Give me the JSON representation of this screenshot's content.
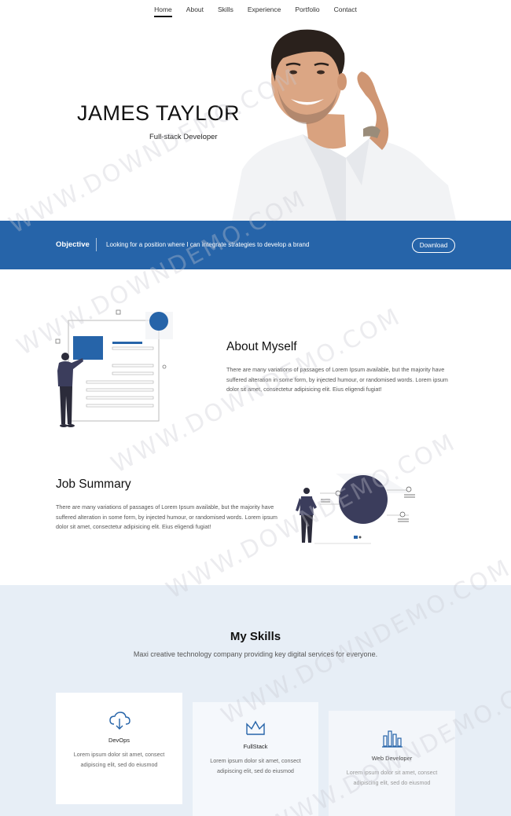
{
  "nav": {
    "items": [
      {
        "label": "Home",
        "active": true
      },
      {
        "label": "About",
        "active": false
      },
      {
        "label": "Skills",
        "active": false
      },
      {
        "label": "Experience",
        "active": false
      },
      {
        "label": "Portfolio",
        "active": false
      },
      {
        "label": "Contact",
        "active": false
      }
    ]
  },
  "hero": {
    "name": "JAMES TAYLOR",
    "role": "Full-stack Developer"
  },
  "objective": {
    "label": "Objective",
    "text": "Looking for a position where I can integrate strategies to develop a brand",
    "button": "Download"
  },
  "about": {
    "title": "About Myself",
    "text": "There are many variations of passages of Lorem Ipsum available, but the majority have suffered alteration in some form, by injected humour, or randomised words. Lorem ipsum dolor sit amet, consectetur adipisicing elit. Eius eligendi fugiat!"
  },
  "job": {
    "title": "Job Summary",
    "text": "There are many variations of passages of Lorem Ipsum available, but the majority have suffered alteration in some form, by injected humour, or randomised words. Lorem ipsum dolor sit amet, consectetur adipisicing elit. Eius eligendi fugiat!"
  },
  "skills": {
    "title": "My Skills",
    "subtitle": "Maxi creative technology company providing key digital services for everyone.",
    "cards": [
      {
        "icon": "cloud-download-icon",
        "title": "DevOps",
        "text": "Lorem ipsum dolor sit amet, consect adipiscing elit, sed do eiusmod"
      },
      {
        "icon": "crown-icon",
        "title": "FullStack",
        "text": "Lorem ipsum dolor sit amet, consect adipiscing elit, sed do eiusmod"
      },
      {
        "icon": "bar-chart-icon",
        "title": "Web Developer",
        "text": "Lorem ipsum dolor sit amet, consect adipiscing elit, sed do eiusmod"
      }
    ]
  },
  "watermark": "WWW.DOWNDEMO.COM",
  "colors": {
    "accent": "#2664a9",
    "navy": "#3b3d5c",
    "skills_bg": "#e7eef6"
  }
}
